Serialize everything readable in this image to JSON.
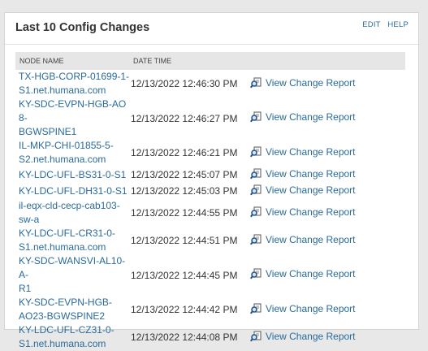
{
  "widget": {
    "title": "Last 10 Config Changes",
    "edit_label": "EDIT",
    "help_label": "HELP"
  },
  "table": {
    "columns": [
      "NODE NAME",
      "DATE TIME",
      ""
    ],
    "rows": [
      {
        "node_line1": "TX-HGB-CORP-01699-1-",
        "node_line2": "S1.net.humana.com",
        "datetime": "12/13/2022 12:46:30 PM",
        "report": "View Change Report"
      },
      {
        "node_line1": "KY-SDC-EVPN-HGB-AO8-",
        "node_line2": "BGWSPINE1",
        "datetime": "12/13/2022 12:46:27 PM",
        "report": "View Change Report"
      },
      {
        "node_line1": "IL-MKP-CHI-01855-5-",
        "node_line2": "S2.net.humana.com",
        "datetime": "12/13/2022 12:46:21 PM",
        "report": "View Change Report"
      },
      {
        "node_line1": "KY-LDC-UFL-BS31-0-S1",
        "node_line2": "",
        "datetime": "12/13/2022 12:45:07 PM",
        "report": "View Change Report"
      },
      {
        "node_line1": "KY-LDC-UFL-DH31-0-S1",
        "node_line2": "",
        "datetime": "12/13/2022 12:45:03 PM",
        "report": "View Change Report"
      },
      {
        "node_line1": "il-eqx-cld-cecp-cab103-",
        "node_line2": "sw-a",
        "datetime": "12/13/2022 12:44:55 PM",
        "report": "View Change Report"
      },
      {
        "node_line1": "KY-LDC-UFL-CR31-0-",
        "node_line2": "S1.net.humana.com",
        "datetime": "12/13/2022 12:44:51 PM",
        "report": "View Change Report"
      },
      {
        "node_line1": "KY-SDC-WANSVI-AL10-A-",
        "node_line2": "R1",
        "datetime": "12/13/2022 12:44:45 PM",
        "report": "View Change Report"
      },
      {
        "node_line1": "KY-SDC-EVPN-HGB-",
        "node_line2": "AO23-BGWSPINE2",
        "datetime": "12/13/2022 12:44:42 PM",
        "report": "View Change Report"
      },
      {
        "node_line1": "KY-LDC-UFL-CZ31-0-",
        "node_line2": "S1.net.humana.com",
        "datetime": "12/13/2022 12:44:08 PM",
        "report": "View Change Report"
      }
    ]
  },
  "colors": {
    "link": "#2a6a9a",
    "header_bg": "#e6e6e6",
    "icon": "magnifier-document-icon"
  }
}
